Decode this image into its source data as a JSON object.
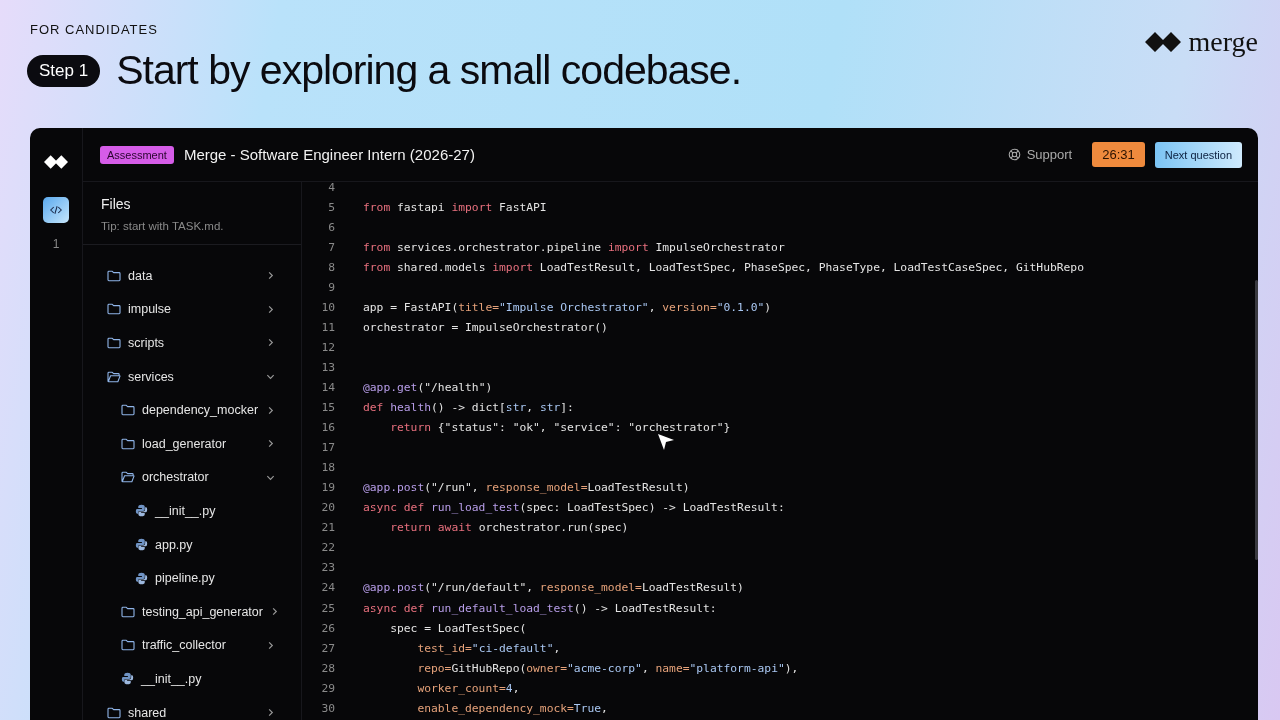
{
  "eyebrow": "FOR CANDIDATES",
  "step": "Step 1",
  "headline": "Start by exploring a small codebase.",
  "brand": "merge",
  "window": {
    "badge": "Assessment",
    "title": "Merge - Software Engineer Intern (2026-27)",
    "support": "Support",
    "timer": "26:31",
    "next_button": "Next question"
  },
  "rail": {
    "count": "1"
  },
  "files": {
    "title": "Files",
    "tip": "Tip: start with TASK.md.",
    "tree": [
      {
        "kind": "folder",
        "name": "data",
        "expanded": false
      },
      {
        "kind": "folder",
        "name": "impulse",
        "expanded": false
      },
      {
        "kind": "folder",
        "name": "scripts",
        "expanded": false
      },
      {
        "kind": "folder",
        "name": "services",
        "expanded": true,
        "children": [
          {
            "kind": "folder",
            "name": "dependency_mocker",
            "expanded": false
          },
          {
            "kind": "folder",
            "name": "load_generator",
            "expanded": false
          },
          {
            "kind": "folder",
            "name": "orchestrator",
            "expanded": true,
            "children": [
              {
                "kind": "file",
                "name": "__init__.py"
              },
              {
                "kind": "file",
                "name": "app.py"
              },
              {
                "kind": "file",
                "name": "pipeline.py"
              }
            ]
          },
          {
            "kind": "folder",
            "name": "testing_api_generator",
            "expanded": false
          },
          {
            "kind": "folder",
            "name": "traffic_collector",
            "expanded": false
          },
          {
            "kind": "file",
            "name": "__init__.py"
          }
        ]
      },
      {
        "kind": "folder",
        "name": "shared",
        "expanded": false
      }
    ]
  },
  "code": [
    {
      "num": "4"
    },
    {
      "num": "5",
      "tokens": [
        {
          "kind": "kw",
          "text": "from"
        },
        {
          "kind": "plain",
          "text": " fastapi "
        },
        {
          "kind": "kw",
          "text": "import"
        },
        {
          "kind": "plain",
          "text": " FastAPI"
        }
      ]
    },
    {
      "num": "6"
    },
    {
      "num": "7",
      "tokens": [
        {
          "kind": "kw",
          "text": "from"
        },
        {
          "kind": "plain",
          "text": " services.orchestrator.pipeline "
        },
        {
          "kind": "kw",
          "text": "import"
        },
        {
          "kind": "plain",
          "text": " ImpulseOrchestrator"
        }
      ]
    },
    {
      "num": "8",
      "tokens": [
        {
          "kind": "kw",
          "text": "from"
        },
        {
          "kind": "plain",
          "text": " shared.models "
        },
        {
          "kind": "kw",
          "text": "import"
        },
        {
          "kind": "plain",
          "text": " LoadTestResult, LoadTestSpec, PhaseSpec, PhaseType, LoadTestCaseSpec, GitHubRepo"
        }
      ]
    },
    {
      "num": "9"
    },
    {
      "num": "10",
      "tokens": [
        {
          "kind": "plain",
          "text": "app = FastAPI("
        },
        {
          "kind": "param",
          "text": "title="
        },
        {
          "kind": "str",
          "text": "\"Impulse Orchestrator\""
        },
        {
          "kind": "plain",
          "text": ", "
        },
        {
          "kind": "param",
          "text": "version="
        },
        {
          "kind": "str",
          "text": "\"0.1.0\""
        },
        {
          "kind": "plain",
          "text": ")"
        }
      ]
    },
    {
      "num": "11",
      "tokens": [
        {
          "kind": "plain",
          "text": "orchestrator = ImpulseOrchestrator()"
        }
      ]
    },
    {
      "num": "12"
    },
    {
      "num": "13"
    },
    {
      "num": "14",
      "tokens": [
        {
          "kind": "fn",
          "text": "@app.get"
        },
        {
          "kind": "plain",
          "text": "(\"/health\")"
        }
      ]
    },
    {
      "num": "15",
      "tokens": [
        {
          "kind": "kw",
          "text": "def "
        },
        {
          "kind": "fn",
          "text": "health"
        },
        {
          "kind": "plain",
          "text": "() -> dict["
        },
        {
          "kind": "str",
          "text": "str"
        },
        {
          "kind": "plain",
          "text": ", "
        },
        {
          "kind": "str",
          "text": "str"
        },
        {
          "kind": "plain",
          "text": "]:"
        }
      ]
    },
    {
      "num": "16",
      "tokens": [
        {
          "kind": "kw",
          "text": "    return"
        },
        {
          "kind": "plain",
          "text": " {\"status\": \"ok\", \"service\": \"orchestrator\"}"
        }
      ]
    },
    {
      "num": "17"
    },
    {
      "num": "18"
    },
    {
      "num": "19",
      "tokens": [
        {
          "kind": "fn",
          "text": "@app.post"
        },
        {
          "kind": "plain",
          "text": "(\"/run\", "
        },
        {
          "kind": "param",
          "text": "response_model="
        },
        {
          "kind": "plain",
          "text": "LoadTestResult)"
        }
      ]
    },
    {
      "num": "20",
      "tokens": [
        {
          "kind": "kw",
          "text": "async def "
        },
        {
          "kind": "fn",
          "text": "run_load_test"
        },
        {
          "kind": "plain",
          "text": "(spec: LoadTestSpec) -> LoadTestResult:"
        }
      ]
    },
    {
      "num": "21",
      "tokens": [
        {
          "kind": "kw",
          "text": "    return await"
        },
        {
          "kind": "plain",
          "text": " orchestrator.run(spec)"
        }
      ]
    },
    {
      "num": "22"
    },
    {
      "num": "23"
    },
    {
      "num": "24",
      "tokens": [
        {
          "kind": "fn",
          "text": "@app.post"
        },
        {
          "kind": "plain",
          "text": "(\"/run/default\", "
        },
        {
          "kind": "param",
          "text": "response_model="
        },
        {
          "kind": "plain",
          "text": "LoadTestResult)"
        }
      ]
    },
    {
      "num": "25",
      "tokens": [
        {
          "kind": "kw",
          "text": "async def "
        },
        {
          "kind": "fn",
          "text": "run_default_load_test"
        },
        {
          "kind": "plain",
          "text": "() -> LoadTestResult:"
        }
      ]
    },
    {
      "num": "26",
      "tokens": [
        {
          "kind": "plain",
          "text": "    spec = LoadTestSpec("
        }
      ]
    },
    {
      "num": "27",
      "tokens": [
        {
          "kind": "param",
          "text": "        test_id="
        },
        {
          "kind": "str",
          "text": "\"ci-default\""
        },
        {
          "kind": "plain",
          "text": ","
        }
      ]
    },
    {
      "num": "28",
      "tokens": [
        {
          "kind": "param",
          "text": "        repo="
        },
        {
          "kind": "plain",
          "text": "GitHubRepo("
        },
        {
          "kind": "param",
          "text": "owner="
        },
        {
          "kind": "str",
          "text": "\"acme-corp\""
        },
        {
          "kind": "plain",
          "text": ", "
        },
        {
          "kind": "param",
          "text": "name="
        },
        {
          "kind": "str",
          "text": "\"platform-api\""
        },
        {
          "kind": "plain",
          "text": "),"
        }
      ]
    },
    {
      "num": "29",
      "tokens": [
        {
          "kind": "param",
          "text": "        worker_count="
        },
        {
          "kind": "str",
          "text": "4"
        },
        {
          "kind": "plain",
          "text": ","
        }
      ]
    },
    {
      "num": "30",
      "tokens": [
        {
          "kind": "param",
          "text": "        enable_dependency_mock="
        },
        {
          "kind": "str",
          "text": "True"
        },
        {
          "kind": "plain",
          "text": ","
        }
      ]
    }
  ]
}
